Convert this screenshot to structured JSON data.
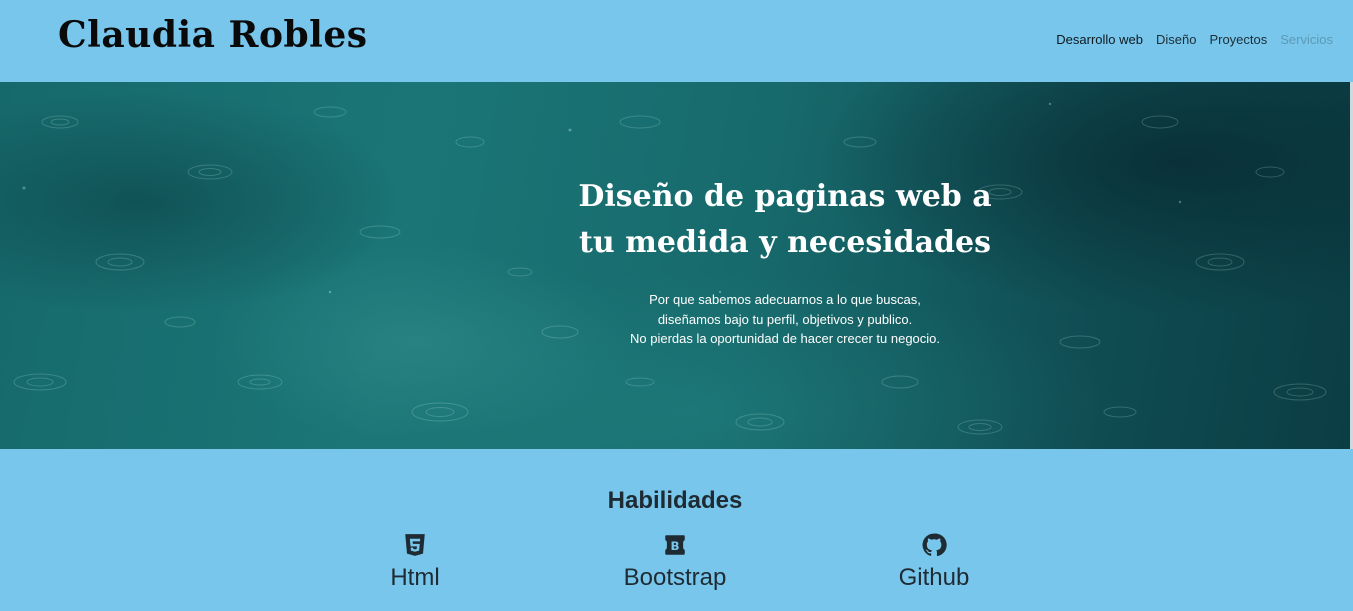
{
  "header": {
    "brand": "Claudia Robles",
    "nav": [
      {
        "label": "Desarrollo web"
      },
      {
        "label": "Diseño"
      },
      {
        "label": "Proyectos"
      },
      {
        "label": "Servicios"
      }
    ]
  },
  "hero": {
    "title_line1": "Diseño de paginas web a",
    "title_line2": "tu medida y necesidades",
    "sub_line1": "Por que sabemos adecuarnos a lo que buscas,",
    "sub_line2": "diseñamos bajo tu perfil, objetivos y publico.",
    "sub_line3": "No pierdas la oportunidad de hacer crecer tu negocio."
  },
  "skills": {
    "title": "Habilidades",
    "items": [
      {
        "label": "Html",
        "icon": "html5-icon"
      },
      {
        "label": "Bootstrap",
        "icon": "bootstrap-icon"
      },
      {
        "label": "Github",
        "icon": "github-icon"
      }
    ]
  },
  "colors": {
    "background": "#78c6ec",
    "hero_water": "#176a6c",
    "text_dark": "#1f2b33",
    "nav_muted": "#5c9bb6"
  }
}
